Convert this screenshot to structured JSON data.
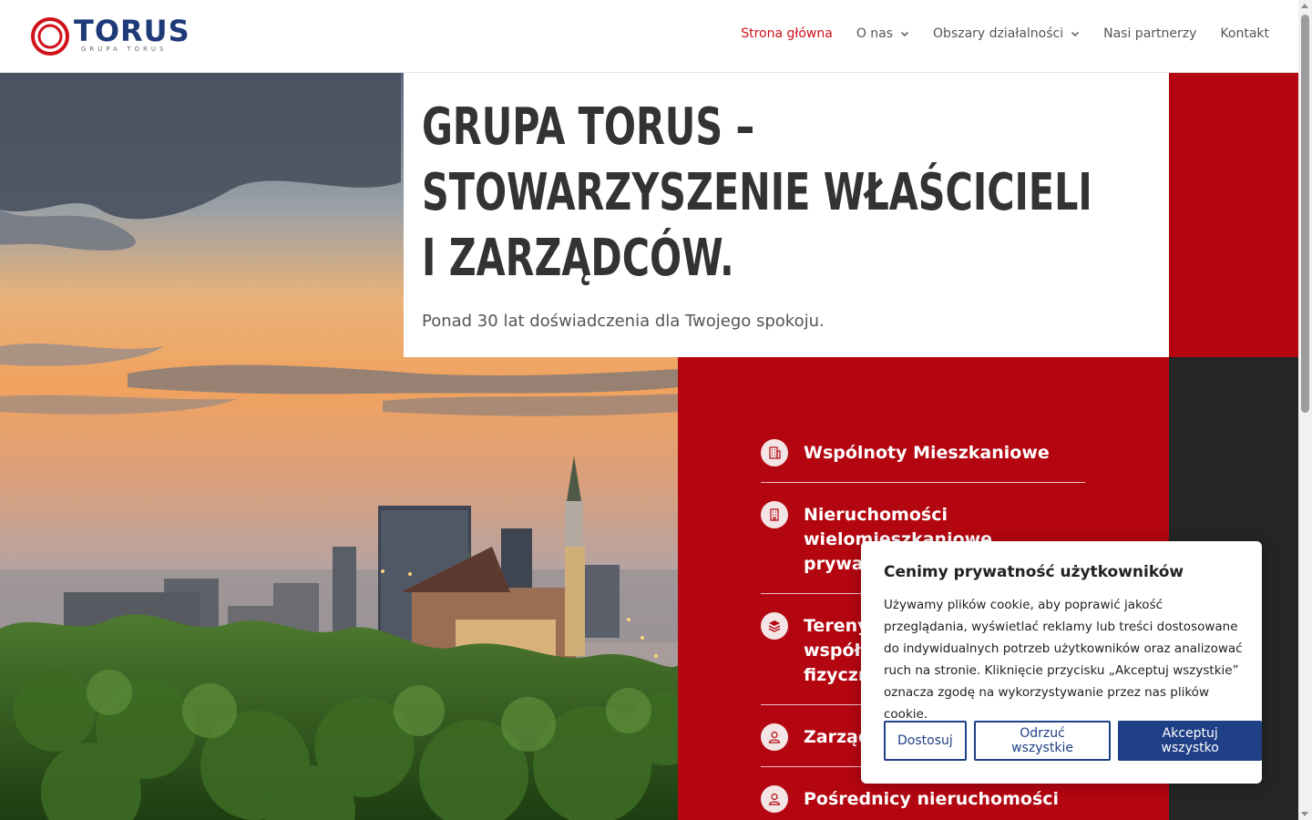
{
  "brand": {
    "name": "TORUS",
    "tagline": "GRUPA TORUS",
    "colors": {
      "navy": "#1f3a78",
      "red": "#d0111a"
    }
  },
  "nav": {
    "items": [
      {
        "label": "Strona główna",
        "active": true,
        "dropdown": false
      },
      {
        "label": "O nas",
        "active": false,
        "dropdown": true
      },
      {
        "label": "Obszary działalności",
        "active": false,
        "dropdown": true
      },
      {
        "label": "Nasi partnerzy",
        "active": false,
        "dropdown": false
      },
      {
        "label": "Kontakt",
        "active": false,
        "dropdown": false
      }
    ]
  },
  "hero": {
    "title_line1": "GRUPA TORUS –",
    "title_line2": "STOWARZYSZENIE WŁAŚCICIELI",
    "title_line3": "I ZARZĄDCÓW.",
    "subtitle": "Ponad 30 lat doświadczenia dla Twojego spokoju."
  },
  "services": [
    {
      "line1": "Wspólnoty Mieszkaniowe",
      "line2": "",
      "line3": "",
      "icon": "building-icon"
    },
    {
      "line1": "Nieruchomości",
      "line2": "wielomieszkaniowe prywatne",
      "line3": "",
      "icon": "office-icon"
    },
    {
      "line1": "Tereny",
      "line2": "współ",
      "line3": "fizyczn",
      "icon": "layers-icon"
    },
    {
      "line1": "Zarząd",
      "line2": "",
      "line3": "",
      "icon": "user-icon"
    },
    {
      "line1": "Pośrednicy nieruchomości",
      "line2": "",
      "line3": "",
      "icon": "user-icon"
    }
  ],
  "cookie": {
    "title": "Cenimy prywatność użytkowników",
    "text": "Używamy plików cookie, aby poprawić jakość przeglądania, wyświetlać reklamy lub treści dostosowane do indywidualnych potrzeb użytkowników oraz analizować ruch na stronie. Kliknięcie przycisku „Akceptuj wszystkie” oznacza zgodę na wykorzystywanie przez nas plików cookie.",
    "btn_customize": "Dostosuj",
    "btn_reject": "Odrzuć wszystkie",
    "btn_accept": "Akceptuj wszystko"
  }
}
